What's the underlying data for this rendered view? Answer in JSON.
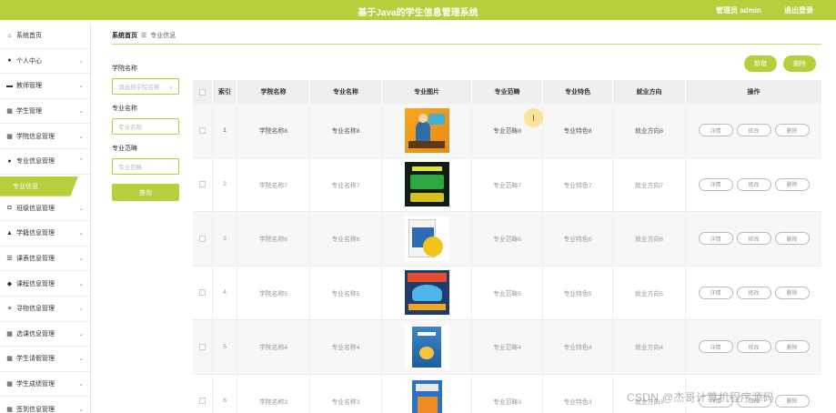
{
  "header": {
    "title": "基于Java的学生信息管理系统",
    "user_label": "管理员 admin",
    "logout_label": "退出登录"
  },
  "sidebar": {
    "items": [
      {
        "label": "系统首页",
        "icon": "home-icon",
        "glyph": "⌂",
        "chevron": false
      },
      {
        "label": "个人中心",
        "icon": "user-icon",
        "glyph": "●",
        "chevron": true
      },
      {
        "label": "教师管理",
        "icon": "teacher-icon",
        "glyph": "▬",
        "chevron": true
      },
      {
        "label": "学生管理",
        "icon": "grid-icon",
        "glyph": "▦",
        "chevron": true
      },
      {
        "label": "学院信息管理",
        "icon": "grid-icon",
        "glyph": "▦",
        "chevron": true
      },
      {
        "label": "专业信息管理",
        "icon": "user-icon",
        "glyph": "●",
        "chevron": true,
        "expanded": true
      }
    ],
    "active_sub": "专业信息",
    "items_after": [
      {
        "label": "班级信息管理",
        "icon": "clipboard-icon",
        "glyph": "◘",
        "chevron": true
      },
      {
        "label": "学籍信息管理",
        "icon": "cap-icon",
        "glyph": "▲",
        "chevron": true
      },
      {
        "label": "课表信息管理",
        "icon": "sliders-icon",
        "glyph": "☰",
        "chevron": true
      },
      {
        "label": "课程信息管理",
        "icon": "thumb-icon",
        "glyph": "◆",
        "chevron": true
      },
      {
        "label": "寻物信息管理",
        "icon": "list-icon",
        "glyph": "≡",
        "chevron": true
      },
      {
        "label": "选课信息管理",
        "icon": "grid-icon",
        "glyph": "▦",
        "chevron": true
      },
      {
        "label": "学生请假管理",
        "icon": "grid-icon",
        "glyph": "▦",
        "chevron": true
      },
      {
        "label": "学生成绩管理",
        "icon": "grid-icon",
        "glyph": "▦",
        "chevron": true
      },
      {
        "label": "签到信息管理",
        "icon": "grid-icon",
        "glyph": "▦",
        "chevron": true
      }
    ]
  },
  "breadcrumb": {
    "home": "系统首页",
    "separator": "☰",
    "current": "专业信息"
  },
  "filter": {
    "college_label": "学院名称",
    "college_placeholder": "请选择学院名称",
    "major_label": "专业名称",
    "major_placeholder": "专业名称",
    "scope_label": "专业范畴",
    "scope_placeholder": "专业范畴",
    "search_button": "查询"
  },
  "actions": {
    "add_label": "新增",
    "delete_label": "删除"
  },
  "table": {
    "columns": [
      "",
      "索引",
      "学院名称",
      "专业名称",
      "专业图片",
      "专业范畴",
      "专业特色",
      "就业方向",
      "操作"
    ],
    "rows": [
      {
        "index": "1",
        "college": "学院名称8",
        "major": "专业名称8",
        "cover": "cover-programming-book",
        "scope": "专业范畴8",
        "feature": "专业特色8",
        "career": "就业方向8",
        "dim": false
      },
      {
        "index": "2",
        "college": "学院名称7",
        "major": "专业名称7",
        "cover": "cover-green-book",
        "scope": "专业范畴7",
        "feature": "专业特色7",
        "career": "就业方向7",
        "dim": true
      },
      {
        "index": "3",
        "college": "学院名称6",
        "major": "专业名称6",
        "cover": "cover-python-book",
        "scope": "专业范畴6",
        "feature": "专业特色6",
        "career": "就业方向6",
        "dim": true
      },
      {
        "index": "4",
        "college": "学院名称5",
        "major": "专业名称5",
        "cover": "cover-blue-book",
        "scope": "专业范畴5",
        "feature": "专业特色5",
        "career": "就业方向5",
        "dim": true
      },
      {
        "index": "5",
        "college": "学院名称4",
        "major": "专业名称4",
        "cover": "cover-python-light-book",
        "scope": "专业范畴4",
        "feature": "专业特色4",
        "career": "就业方向4",
        "dim": true
      },
      {
        "index": "6",
        "college": "学院名称3",
        "major": "专业名称3",
        "cover": "cover-tech-book",
        "scope": "专业范畴3",
        "feature": "专业特色3",
        "career": "就业方向3",
        "dim": true
      }
    ],
    "row_actions": {
      "detail": "详情",
      "edit": "修改",
      "delete": "删除"
    }
  },
  "cursor_glyph": "I",
  "watermark": "CSDN @杰哥计算机程序源码",
  "colors": {
    "accent": "#b6cf3c",
    "header_bg": "#efefef"
  }
}
